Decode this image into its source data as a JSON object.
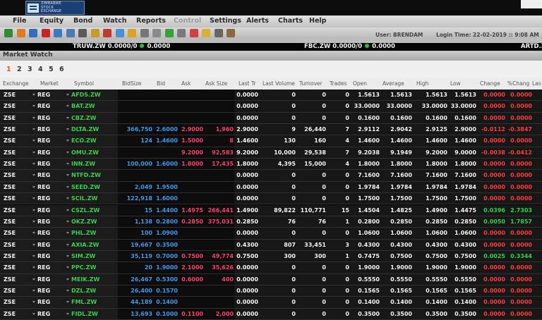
{
  "brand": {
    "logo_lines": [
      "ZIMBABWE",
      "STOCK",
      "EXCHANGE"
    ]
  },
  "menu": [
    {
      "label": "File",
      "enabled": true
    },
    {
      "label": "Equity",
      "enabled": true
    },
    {
      "label": "Bond",
      "enabled": true
    },
    {
      "label": "Watch",
      "enabled": true
    },
    {
      "label": "Reports",
      "enabled": true
    },
    {
      "label": "Control",
      "enabled": false
    },
    {
      "label": "Settings",
      "enabled": true
    },
    {
      "label": "Alerts",
      "enabled": true
    },
    {
      "label": "Charts",
      "enabled": true
    },
    {
      "label": "Help",
      "enabled": true
    }
  ],
  "toolbar_icons": [
    {
      "name": "sync-icon",
      "color": "#2f8a3a"
    },
    {
      "name": "refresh-icon",
      "color": "#e07a1a"
    },
    {
      "name": "globe-icon",
      "color": "#2f6fc0"
    },
    {
      "name": "stop-icon",
      "color": "#cc2222"
    },
    {
      "name": "user-icon",
      "color": "#3b7ac2"
    },
    {
      "name": "folder-icon",
      "color": "#4a7ab3"
    },
    {
      "name": "grid-icon",
      "color": "#5a5a5a"
    },
    {
      "name": "edit-icon",
      "color": "#c79a2a"
    },
    {
      "name": "chart-icon",
      "color": "#c0392b"
    },
    {
      "name": "table-icon",
      "color": "#4a90d9"
    },
    {
      "name": "order-icon",
      "color": "#e0a020"
    },
    {
      "name": "settings-icon",
      "color": "#777777"
    },
    {
      "name": "window-icon",
      "color": "#8a8a8a"
    },
    {
      "name": "check-icon",
      "color": "#3aa03a"
    },
    {
      "name": "list-icon",
      "color": "#7a7a7a"
    },
    {
      "name": "alert-icon",
      "color": "#d04040"
    },
    {
      "name": "note-icon",
      "color": "#d9b030"
    },
    {
      "name": "cut-icon",
      "color": "#666666"
    },
    {
      "name": "tool-icon",
      "color": "#8a6a3a"
    }
  ],
  "session": {
    "user_label": "User: BRENDAM",
    "login_label": "Login Time: 22-02-2019 :: 9:08 AM"
  },
  "ticker": [
    {
      "symbol": "TRUW.ZW 0.0000/0",
      "value": "0.0000"
    },
    {
      "symbol": "FBC.ZW 0.0000/0",
      "value": "0.0000"
    },
    {
      "symbol": "ARTD.Z",
      "value": ""
    }
  ],
  "window_title": "Market Watch",
  "pages": [
    "1",
    "2",
    "3",
    "4",
    "5",
    "6"
  ],
  "active_page": "1",
  "columns": [
    "Exchange",
    "Market",
    "Symbol",
    "BidSize",
    "Bid",
    "Ask",
    "Ask Size",
    "Last Tr",
    "Last Volume",
    "Turnover",
    "Trades",
    "Open",
    "Average",
    "High",
    "Low",
    "Change",
    "%Chang",
    "Las"
  ],
  "rows": [
    {
      "exchange": "ZSE",
      "market": "REG",
      "symbol": "AFDS.ZW",
      "bidsize": "",
      "bid": "",
      "ask": "",
      "asksize": "",
      "last": "0.0000",
      "lastvol": "0",
      "turnover": "0",
      "trades": "0",
      "open": "1.5613",
      "avg": "1.5613",
      "high": "1.5613",
      "low": "1.5613",
      "change": "0.0000",
      "pct": "0.0000"
    },
    {
      "exchange": "ZSE",
      "market": "REG",
      "symbol": "BAT.ZW",
      "bidsize": "",
      "bid": "",
      "ask": "",
      "asksize": "",
      "last": "0.0000",
      "lastvol": "0",
      "turnover": "0",
      "trades": "0",
      "open": "33.0000",
      "avg": "33.0000",
      "high": "33.0000",
      "low": "33.0000",
      "change": "0.0000",
      "pct": "0.0000"
    },
    {
      "exchange": "ZSE",
      "market": "REG",
      "symbol": "CBZ.ZW",
      "bidsize": "",
      "bid": "",
      "ask": "",
      "asksize": "",
      "last": "0.0000",
      "lastvol": "0",
      "turnover": "0",
      "trades": "0",
      "open": "0.1600",
      "avg": "0.1600",
      "high": "0.1600",
      "low": "0.1600",
      "change": "0.0000",
      "pct": "0.0000"
    },
    {
      "exchange": "ZSE",
      "market": "REG",
      "symbol": "DLTA.ZW",
      "bidsize": "366,750",
      "bid": "2.6000",
      "ask": "2.9000",
      "asksize": "1,960",
      "last": "2.9000",
      "lastvol": "9",
      "turnover": "26,440",
      "trades": "7",
      "open": "2.9112",
      "avg": "2.9042",
      "high": "2.9125",
      "low": "2.9000",
      "change": "-0.0112",
      "pct": "-0.3847"
    },
    {
      "exchange": "ZSE",
      "market": "REG",
      "symbol": "ECO.ZW",
      "bidsize": "124",
      "bid": "1.4600",
      "ask": "1.5000",
      "asksize": "8",
      "last": "1.4600",
      "lastvol": "130",
      "turnover": "160",
      "trades": "4",
      "open": "1.4600",
      "avg": "1.4600",
      "high": "1.4600",
      "low": "1.4600",
      "change": "0.0000",
      "pct": "0.0000"
    },
    {
      "exchange": "ZSE",
      "market": "REG",
      "symbol": "OMU.ZW",
      "bidsize": "",
      "bid": "",
      "ask": "9.2000",
      "asksize": "92,583",
      "last": "9.2000",
      "lastvol": "10,000",
      "turnover": "29,538",
      "trades": "7",
      "open": "9.2038",
      "avg": "9.1949",
      "high": "9.2000",
      "low": "9.0000",
      "change": "-0.0038",
      "pct": "-0.0412"
    },
    {
      "exchange": "ZSE",
      "market": "REG",
      "symbol": "INN.ZW",
      "bidsize": "100,000",
      "bid": "1.6000",
      "ask": "1.8000",
      "asksize": "17,435",
      "last": "1.8000",
      "lastvol": "4,395",
      "turnover": "15,000",
      "trades": "4",
      "open": "1.8000",
      "avg": "1.8000",
      "high": "1.8000",
      "low": "1.8000",
      "change": "0.0000",
      "pct": "0.0000"
    },
    {
      "exchange": "ZSE",
      "market": "REG",
      "symbol": "NTFD.ZW",
      "bidsize": "",
      "bid": "",
      "ask": "",
      "asksize": "",
      "last": "0.0000",
      "lastvol": "0",
      "turnover": "0",
      "trades": "0",
      "open": "7.1600",
      "avg": "7.1600",
      "high": "7.1600",
      "low": "7.1600",
      "change": "0.0000",
      "pct": "0.0000"
    },
    {
      "exchange": "ZSE",
      "market": "REG",
      "symbol": "SEED.ZW",
      "bidsize": "2,049",
      "bid": "1.9500",
      "ask": "",
      "asksize": "",
      "last": "0.0000",
      "lastvol": "0",
      "turnover": "0",
      "trades": "0",
      "open": "1.9784",
      "avg": "1.9784",
      "high": "1.9784",
      "low": "1.9784",
      "change": "0.0000",
      "pct": "0.0000"
    },
    {
      "exchange": "ZSE",
      "market": "REG",
      "symbol": "SCIL.ZW",
      "bidsize": "122,918",
      "bid": "1.6000",
      "ask": "",
      "asksize": "",
      "last": "0.0000",
      "lastvol": "0",
      "turnover": "0",
      "trades": "0",
      "open": "1.7500",
      "avg": "1.7500",
      "high": "1.7500",
      "low": "1.7500",
      "change": "0.0000",
      "pct": "0.0000"
    },
    {
      "exchange": "ZSE",
      "market": "REG",
      "symbol": "CSZL.ZW",
      "bidsize": "15",
      "bid": "1.4400",
      "ask": "1.4975",
      "asksize": "266,441",
      "last": "1.4900",
      "lastvol": "89,822",
      "turnover": "110,771",
      "trades": "15",
      "open": "1.4504",
      "avg": "1.4825",
      "high": "1.4900",
      "low": "1.4475",
      "change": "0.0396",
      "pct": "2.7303"
    },
    {
      "exchange": "ZSE",
      "market": "REG",
      "symbol": "OKZ.ZW",
      "bidsize": "1,138",
      "bid": "0.2800",
      "ask": "0.2850",
      "asksize": "375,031",
      "last": "0.2850",
      "lastvol": "76",
      "turnover": "76",
      "trades": "1",
      "open": "0.2800",
      "avg": "0.2850",
      "high": "0.2850",
      "low": "0.2850",
      "change": "0.0050",
      "pct": "1.7857"
    },
    {
      "exchange": "ZSE",
      "market": "REG",
      "symbol": "PHL.ZW",
      "bidsize": "100",
      "bid": "1.0900",
      "ask": "",
      "asksize": "",
      "last": "0.0000",
      "lastvol": "0",
      "turnover": "0",
      "trades": "0",
      "open": "1.0600",
      "avg": "1.0600",
      "high": "1.0600",
      "low": "1.0600",
      "change": "0.0000",
      "pct": "0.0000"
    },
    {
      "exchange": "ZSE",
      "market": "REG",
      "symbol": "AXIA.ZW",
      "bidsize": "19,667",
      "bid": "0.3500",
      "ask": "",
      "asksize": "",
      "last": "0.4300",
      "lastvol": "807",
      "turnover": "33,451",
      "trades": "3",
      "open": "0.4300",
      "avg": "0.4300",
      "high": "0.4300",
      "low": "0.4300",
      "change": "0.0000",
      "pct": "0.0000"
    },
    {
      "exchange": "ZSE",
      "market": "REG",
      "symbol": "SIM.ZW",
      "bidsize": "35,119",
      "bid": "0.7000",
      "ask": "0.7500",
      "asksize": "49,774",
      "last": "0.7500",
      "lastvol": "300",
      "turnover": "300",
      "trades": "1",
      "open": "0.7475",
      "avg": "0.7500",
      "high": "0.7500",
      "low": "0.7500",
      "change": "0.0025",
      "pct": "0.3344"
    },
    {
      "exchange": "ZSE",
      "market": "REG",
      "symbol": "PPC.ZW",
      "bidsize": "20",
      "bid": "1.9000",
      "ask": "2.1000",
      "asksize": "35,626",
      "last": "0.0000",
      "lastvol": "0",
      "turnover": "0",
      "trades": "0",
      "open": "1.9000",
      "avg": "1.9000",
      "high": "1.9000",
      "low": "1.9000",
      "change": "0.0000",
      "pct": "0.0000"
    },
    {
      "exchange": "ZSE",
      "market": "REG",
      "symbol": "MEIK.ZW",
      "bidsize": "26,467",
      "bid": "0.5300",
      "ask": "0.6000",
      "asksize": "400",
      "last": "0.0000",
      "lastvol": "0",
      "turnover": "0",
      "trades": "0",
      "open": "0.5550",
      "avg": "0.5550",
      "high": "0.5550",
      "low": "0.5550",
      "change": "0.0000",
      "pct": "0.0000"
    },
    {
      "exchange": "ZSE",
      "market": "REG",
      "symbol": "DZL.ZW",
      "bidsize": "26,400",
      "bid": "0.1570",
      "ask": "",
      "asksize": "",
      "last": "0.0000",
      "lastvol": "0",
      "turnover": "0",
      "trades": "0",
      "open": "0.1565",
      "avg": "0.1565",
      "high": "0.1565",
      "low": "0.1565",
      "change": "0.0000",
      "pct": "0.0000"
    },
    {
      "exchange": "ZSE",
      "market": "REG",
      "symbol": "FML.ZW",
      "bidsize": "44,189",
      "bid": "0.1400",
      "ask": "",
      "asksize": "",
      "last": "0.0000",
      "lastvol": "0",
      "turnover": "0",
      "trades": "0",
      "open": "0.1400",
      "avg": "0.1400",
      "high": "0.1400",
      "low": "0.1400",
      "change": "0.0000",
      "pct": "0.0000"
    },
    {
      "exchange": "ZSE",
      "market": "REG",
      "symbol": "FIDL.ZW",
      "bidsize": "13,693",
      "bid": "0.1000",
      "ask": "0.1100",
      "asksize": "2,000",
      "last": "0.0000",
      "lastvol": "0",
      "turnover": "0",
      "trades": "0",
      "open": "0.3500",
      "avg": "0.3500",
      "high": "0.3500",
      "low": "0.3500",
      "change": "0.0000",
      "pct": "0.0000"
    }
  ],
  "colors": {
    "symbol": "#35d34a",
    "bid": "#3d9be9",
    "ask": "#ff3e6c",
    "positive": "#2fd34a",
    "negative": "#ff3a3a",
    "text": "#f2f2f2",
    "pager_active": "#e06000"
  }
}
